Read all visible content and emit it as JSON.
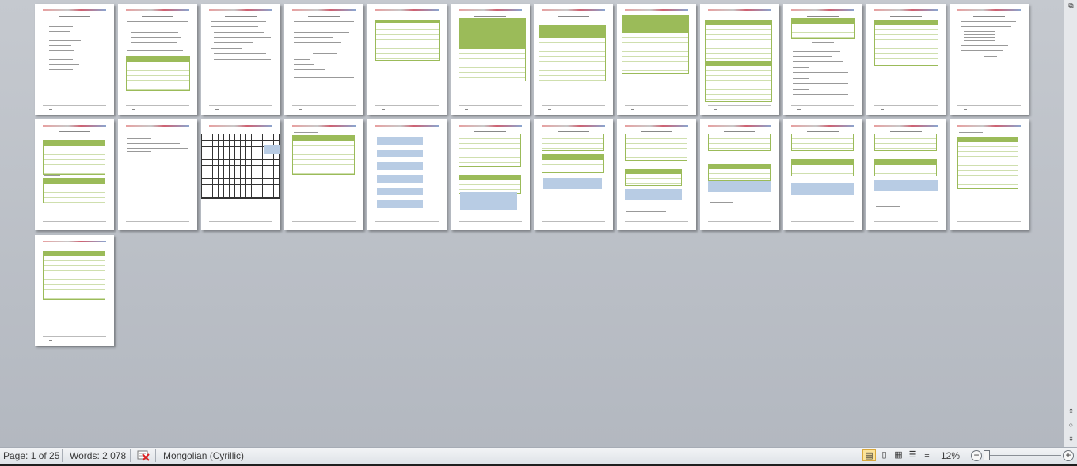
{
  "status": {
    "page": "Page: 1 of 25",
    "words": "Words: 2 078",
    "language": "Mongolian (Cyrillic)",
    "zoom": "12%"
  },
  "zoom_minus_label": "−",
  "zoom_plus_label": "+",
  "colors": {
    "table_green": "#9bbb59",
    "highlight_blue": "#b8cce4",
    "workspace": "#b9bec6"
  },
  "icons": {
    "proofing": "proofing-error-icon",
    "print_layout": "print-layout-view-icon",
    "full_screen": "full-screen-reading-view-icon",
    "web_layout": "web-layout-view-icon",
    "outline": "outline-view-icon",
    "draft": "draft-view-icon"
  }
}
